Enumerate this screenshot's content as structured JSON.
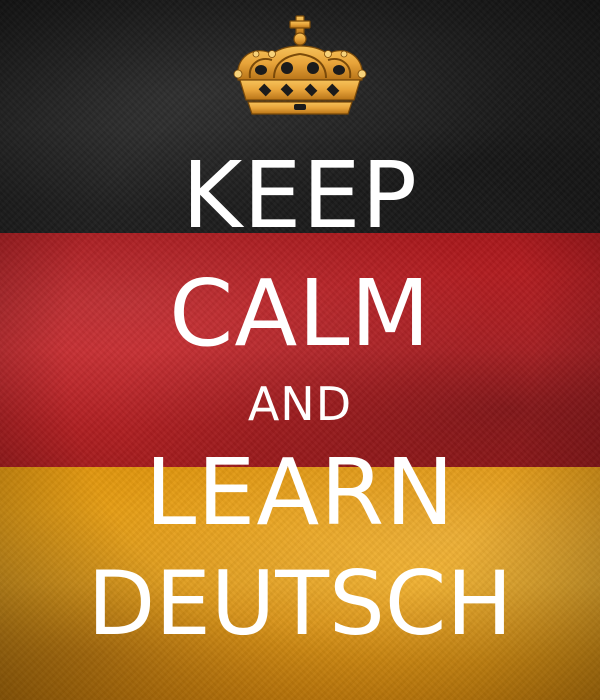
{
  "poster": {
    "lines": [
      "KEEP",
      "CALM",
      "AND",
      "LEARN",
      "DEUTSCH"
    ],
    "crown_icon": "crown-icon",
    "colors": {
      "black_stripe": "#222222",
      "red_stripe": "#c0222a",
      "gold_stripe": "#eaa01c",
      "text": "#ffffff",
      "crown": "#e8a43a"
    }
  }
}
